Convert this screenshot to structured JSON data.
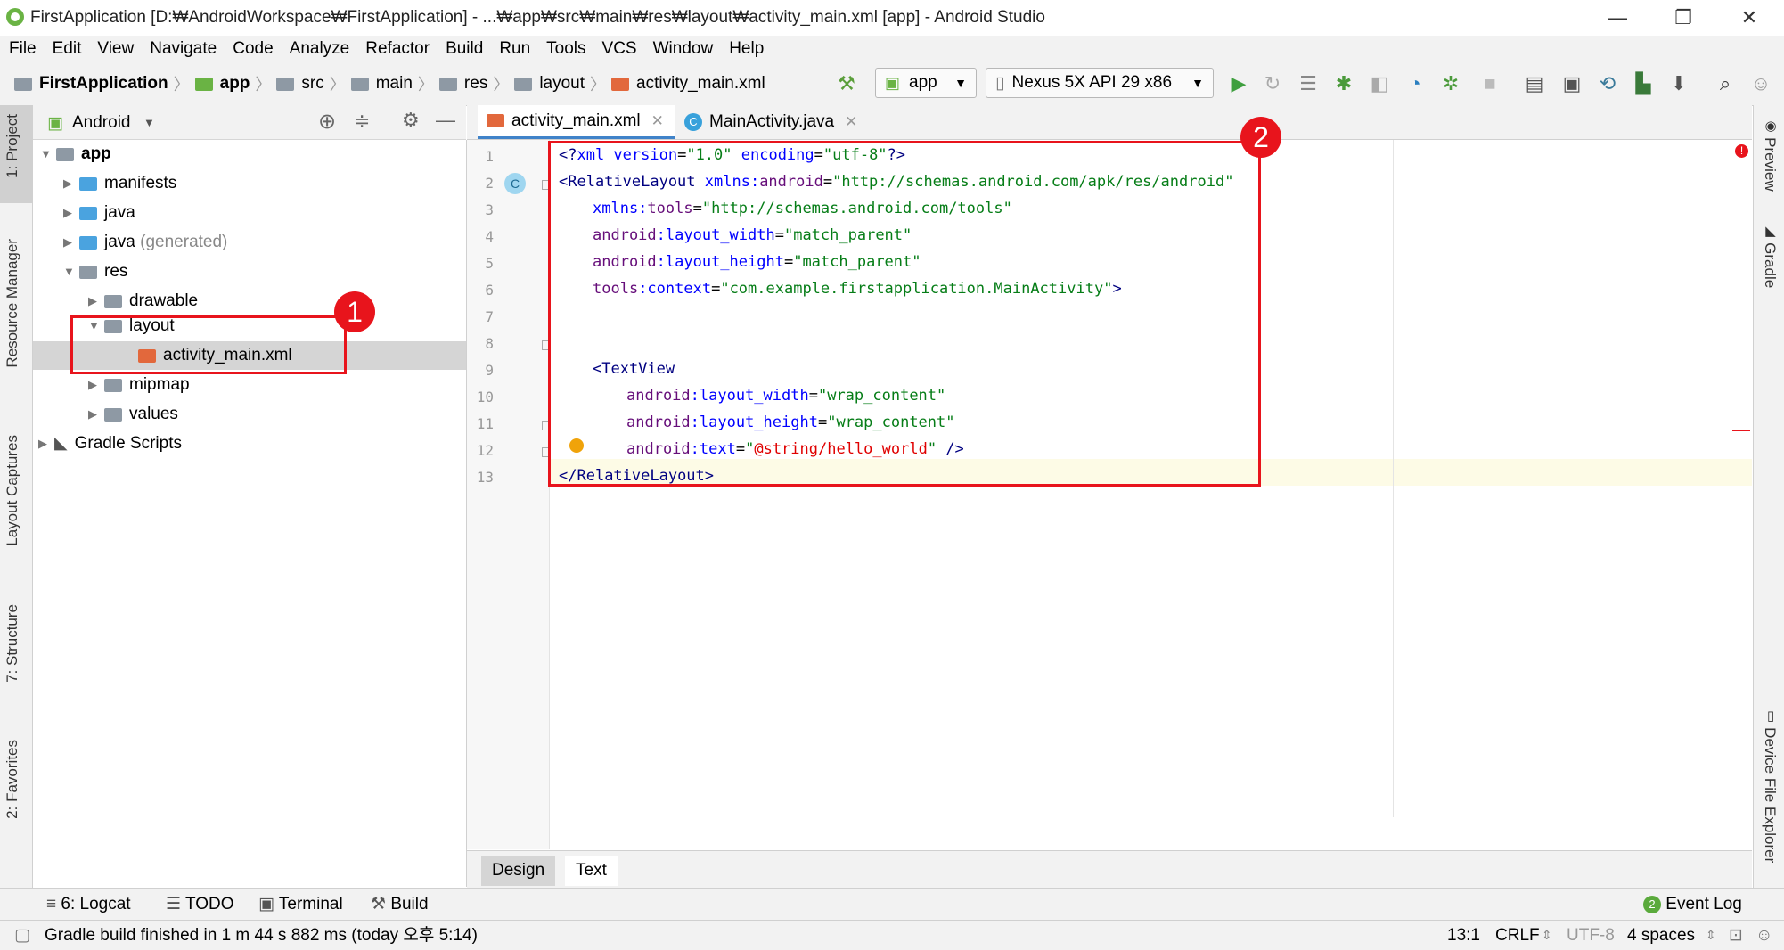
{
  "window": {
    "title": "FirstApplication [D:₩AndroidWorkspace₩FirstApplication] - ...₩app₩src₩main₩res₩layout₩activity_main.xml [app] - Android Studio",
    "minimize": "—",
    "restore": "❐",
    "close": "✕"
  },
  "menu": [
    "File",
    "Edit",
    "View",
    "Navigate",
    "Code",
    "Analyze",
    "Refactor",
    "Build",
    "Run",
    "Tools",
    "VCS",
    "Window",
    "Help"
  ],
  "breadcrumb": [
    "FirstApplication",
    "app",
    "src",
    "main",
    "res",
    "layout",
    "activity_main.xml"
  ],
  "toolbar": {
    "run_config": "app",
    "device": "Nexus 5X API 29 x86"
  },
  "left_tabs": [
    "1: Project",
    "Resource Manager",
    "Layout Captures",
    "7: Structure",
    "2: Favorites"
  ],
  "right_tabs": [
    "Preview",
    "Gradle",
    "Device File Explorer"
  ],
  "project": {
    "view": "Android",
    "tree": [
      {
        "label": "app",
        "bold": true
      },
      {
        "label": "manifests"
      },
      {
        "label": "java"
      },
      {
        "label": "java",
        "suffix": "(generated)"
      },
      {
        "label": "res"
      },
      {
        "label": "drawable"
      },
      {
        "label": "layout"
      },
      {
        "label": "activity_main.xml"
      },
      {
        "label": "mipmap"
      },
      {
        "label": "values"
      },
      {
        "label": "Gradle Scripts"
      }
    ]
  },
  "editor_tabs": [
    "activity_main.xml",
    "MainActivity.java"
  ],
  "code": {
    "line_numbers": [
      "1",
      "2",
      "3",
      "4",
      "5",
      "6",
      "7",
      "8",
      "9",
      "10",
      "11",
      "12",
      "13"
    ],
    "l1": {
      "a": "<?",
      "b": "xml version",
      "c": "=",
      "d": "\"1.0\"",
      "e": " encoding",
      "f": "=",
      "g": "\"utf-8\"",
      "h": "?>"
    },
    "l2": {
      "a": "<RelativeLayout ",
      "b": "xmlns:",
      "c": "android",
      "d": "=",
      "e": "\"http://schemas.android.com/apk/res/android\""
    },
    "l3": {
      "a": "xmlns:",
      "b": "tools",
      "c": "=",
      "d": "\"http://schemas.android.com/tools\""
    },
    "l4": {
      "a": "android",
      "b": ":layout_width",
      "c": "=",
      "d": "\"match_parent\""
    },
    "l5": {
      "a": "android",
      "b": ":layout_height",
      "c": "=",
      "d": "\"match_parent\""
    },
    "l6": {
      "a": "tools",
      "b": ":context",
      "c": "=",
      "d": "\"com.example.firstapplication.MainActivity\"",
      "e": ">"
    },
    "l8": {
      "a": "<TextView"
    },
    "l9": {
      "a": "android",
      "b": ":layout_width",
      "c": "=",
      "d": "\"wrap_content\""
    },
    "l10": {
      "a": "android",
      "b": ":layout_height",
      "c": "=",
      "d": "\"wrap_content\""
    },
    "l11": {
      "a": "android",
      "b": ":text",
      "c": "=",
      "d": "\"",
      "e": "@string/hello_world",
      "f": "\"",
      "g": " />"
    },
    "l12": {
      "a": "</",
      "b": "RelativeLayout",
      "c": ">"
    }
  },
  "design_tabs": [
    "Design",
    "Text"
  ],
  "bottom_tools": [
    "6: Logcat",
    "TODO",
    "Terminal",
    "Build",
    "Event Log"
  ],
  "event_log_count": "2",
  "status": {
    "message": "Gradle build finished in 1 m 44 s 882 ms (today 오후 5:14)",
    "position": "13:1",
    "line_sep": "CRLF",
    "encoding": "UTF-8",
    "indent": "4 spaces"
  },
  "annotations": [
    "1",
    "2"
  ],
  "colors": {
    "annotation_red": "#e8141c",
    "selection": "#d5d5d5",
    "accent_blue": "#4083c9"
  }
}
